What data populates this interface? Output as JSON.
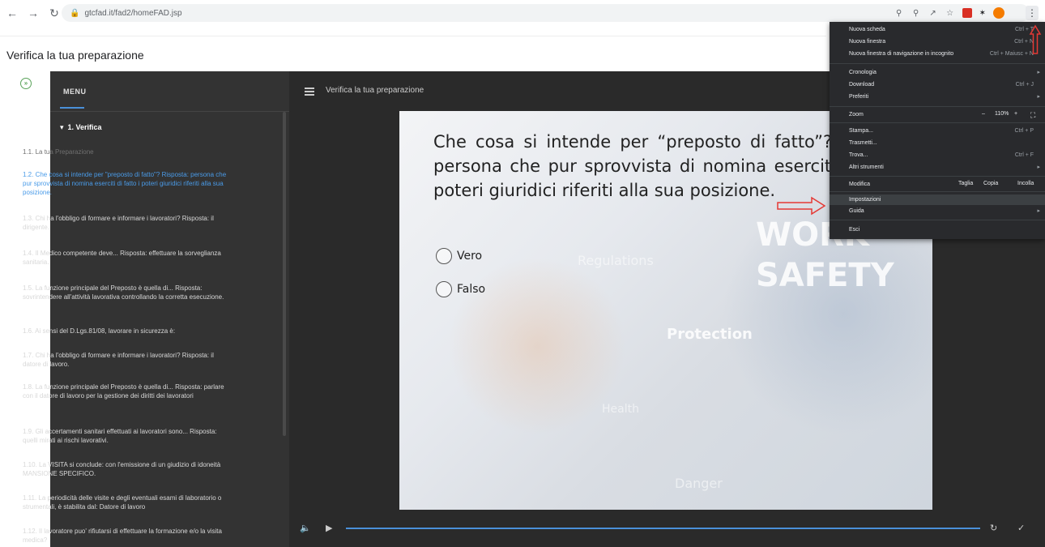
{
  "browser": {
    "url": "gtcfad.it/fad2/homeFAD.jsp"
  },
  "page": {
    "title": "Verifica la tua preparazione"
  },
  "sidebar": {
    "menu_label": "MENU",
    "section": "1. Verifica",
    "items": [
      {
        "label": "1.1. La tua Preparazione",
        "state": "dim"
      },
      {
        "label": "1.2. Che cosa si intende per \"preposto di fatto\"? Risposta: persona che pur sprovvista di nomina eserciti di fatto i poteri giuridici riferiti alla sua posizione.",
        "state": "active"
      },
      {
        "label": "1.3. Chi ha l'obbligo di formare e informare i lavoratori? Risposta: il dirigente.",
        "state": "normal"
      },
      {
        "label": "1.4. Il Medico competente deve... Risposta: effettuare la sorveglianza sanitaria.",
        "state": "normal"
      },
      {
        "label": "1.5. La funzione principale del Preposto è quella di... Risposta: sovrintendere all'attività lavorativa controllando la corretta esecuzione.",
        "state": "normal"
      },
      {
        "label": "1.6. Ai sensi del D.Lgs.81/08, lavorare in sicurezza è:",
        "state": "normal"
      },
      {
        "label": "1.7. Chi ha l'obbligo di formare e informare i lavoratori? Risposta: il datore di lavoro.",
        "state": "normal"
      },
      {
        "label": "1.8. La funzione principale del Preposto è quella di... Risposta: parlare con il datore di lavoro per la gestione dei diritti dei lavoratori",
        "state": "normal"
      },
      {
        "label": "1.9. Gli accertamenti sanitari effettuati ai lavoratori sono... Risposta: quelli mirati ai rischi lavorativi.",
        "state": "normal"
      },
      {
        "label": "1.10. La VISITA si conclude: con l'emissione di un giudizio di idoneità MANSIONE SPECIFICO.",
        "state": "normal"
      },
      {
        "label": "1.11. La periodicità delle visite e degli eventuali esami di laboratorio o strumentali, è stabilita dal: Datore di lavoro",
        "state": "normal"
      },
      {
        "label": "1.12. Il lavoratore puo' rifiutarsi di effettuare la formazione e/o la visita medica?",
        "state": "normal"
      }
    ]
  },
  "player": {
    "title": "Verifica la tua preparazione"
  },
  "slide": {
    "question": "Che cosa si intende per “preposto di fatto”? Risposta: persona che pur sprovvista di nomina eserciti di fatto i poteri giuridici riferiti alla sua posizione.",
    "options": [
      "Vero",
      "Falso"
    ],
    "watermarks": {
      "w1": "WORK",
      "w2": "SAFETY",
      "w3": "Protection",
      "w4": "Regulations",
      "w5": "Health",
      "w6": "Danger"
    }
  },
  "chrome_menu": {
    "new_tab": "Nuova scheda",
    "new_tab_sc": "Ctrl + T",
    "new_window": "Nuova finestra",
    "new_window_sc": "Ctrl + N",
    "incognito": "Nuova finestra di navigazione in incognito",
    "incognito_sc": "Ctrl + Maiusc + N",
    "history": "Cronologia",
    "downloads": "Download",
    "downloads_sc": "Ctrl + J",
    "bookmarks": "Preferiti",
    "zoom": "Zoom",
    "zoom_minus": "–",
    "zoom_value": "110%",
    "zoom_plus": "+",
    "print": "Stampa...",
    "print_sc": "Ctrl + P",
    "cast": "Trasmetti...",
    "find": "Trova...",
    "find_sc": "Ctrl + F",
    "more_tools": "Altri strumenti",
    "edit": "Modifica",
    "cut": "Taglia",
    "copy": "Copia",
    "paste": "Incolla",
    "settings": "Impostazioni",
    "help": "Guida",
    "exit": "Esci"
  },
  "colors": {
    "annotation_red": "#e53935",
    "accent_blue": "#4a90d9"
  }
}
